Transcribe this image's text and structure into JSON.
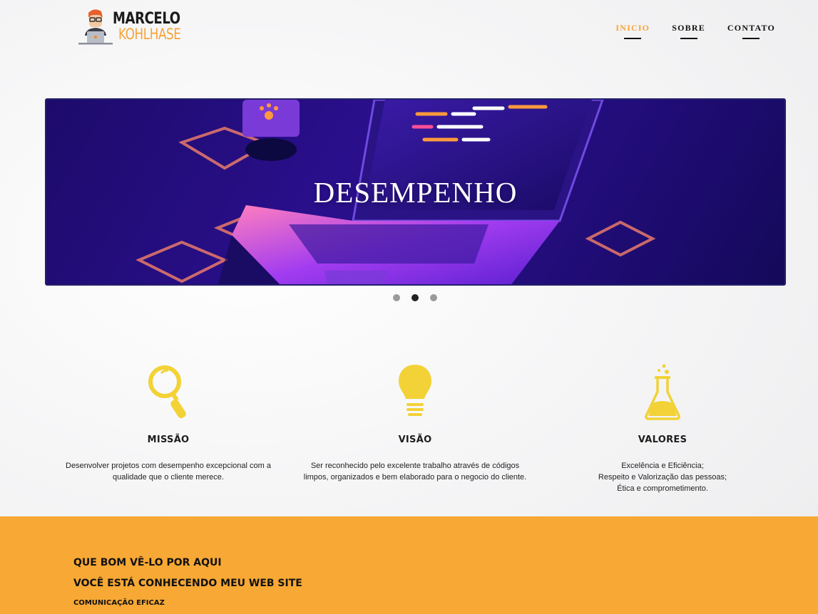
{
  "header": {
    "logo_line1": "MARCELO",
    "logo_line2": "KOHLHASE",
    "nav": [
      {
        "label": "INICIO",
        "active": true
      },
      {
        "label": "SOBRE",
        "active": false
      },
      {
        "label": "CONTATO",
        "active": false
      }
    ]
  },
  "slider": {
    "title": "DESEMPENHO",
    "dots": 3,
    "active_dot": 2
  },
  "features": [
    {
      "icon": "magnifier-icon",
      "title": "MISSÃO",
      "text": "Desenvolver projetos com desempenho excepcional com a\nqualidade que o cliente merece."
    },
    {
      "icon": "lightbulb-icon",
      "title": "VISÃO",
      "text": "Ser reconhecido pelo excelente trabalho através de códigos\nlimpos, organizados e bem elaborado para o negocio do cliente."
    },
    {
      "icon": "flask-icon",
      "title": "VALORES",
      "text": "Excelência e Eficiência;\nRespeito e Valorização das pessoas;\nÉtica e comprometimento."
    }
  ],
  "band": {
    "line1": "QUE BOM VÊ-LO POR AQUI",
    "line2": "VOCÊ ESTÁ CONHECENDO MEU WEB SITE",
    "line3": "COMUNICAÇÃO EFICAZ"
  },
  "colors": {
    "accent": "#f7a335",
    "band": "#f8a834",
    "icon_yellow": "#f2d236",
    "slider_bg": "#2a0f8c"
  }
}
